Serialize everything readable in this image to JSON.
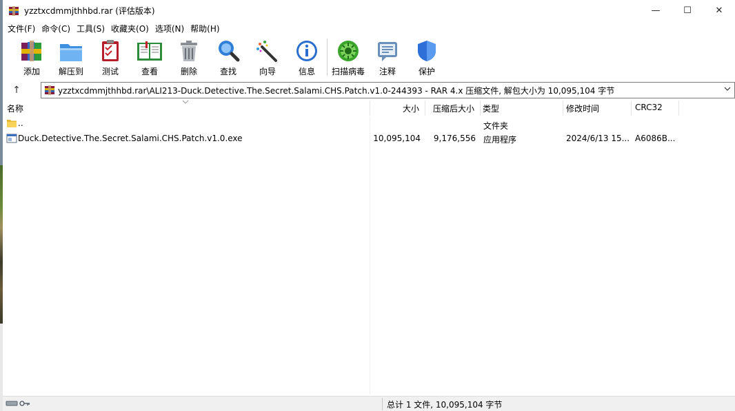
{
  "window": {
    "title": "yzztxcdmmjthhbd.rar (评估版本)",
    "minimize_glyph": "—",
    "maximize_glyph": "☐",
    "close_glyph": "✕"
  },
  "menu": [
    "文件(F)",
    "命令(C)",
    "工具(S)",
    "收藏夹(O)",
    "选项(N)",
    "帮助(H)"
  ],
  "toolbar": [
    {
      "label": "添加",
      "icon": "archive-books-icon"
    },
    {
      "label": "解压到",
      "icon": "folder-extract-icon"
    },
    {
      "label": "测试",
      "icon": "checklist-icon"
    },
    {
      "label": "查看",
      "icon": "open-book-icon"
    },
    {
      "label": "删除",
      "icon": "trash-bin-icon"
    },
    {
      "label": "查找",
      "icon": "magnifier-icon"
    },
    {
      "label": "向导",
      "icon": "magic-wand-icon"
    },
    {
      "label": "信息",
      "icon": "info-icon"
    },
    {
      "label": "扫描病毒",
      "icon": "virus-scan-icon"
    },
    {
      "label": "注释",
      "icon": "comment-icon"
    },
    {
      "label": "保护",
      "icon": "shield-icon"
    }
  ],
  "address": {
    "path": "yzztxcdmmjthhbd.rar\\ALI213-Duck.Detective.The.Secret.Salami.CHS.Patch.v1.0-244393 - RAR 4.x 压缩文件, 解包大小为 10,095,104 字节",
    "up_glyph": "↑"
  },
  "columns": {
    "name": "名称",
    "size": "大小",
    "packed": "压缩后大小",
    "type": "类型",
    "modified": "修改时间",
    "crc": "CRC32"
  },
  "rows": [
    {
      "name": "..",
      "size": "",
      "packed": "",
      "type": "文件夹",
      "modified": "",
      "crc": "",
      "icon": "folder-up-icon"
    },
    {
      "name": "Duck.Detective.The.Secret.Salami.CHS.Patch.v1.0.exe",
      "size": "10,095,104",
      "packed": "9,176,556",
      "type": "应用程序",
      "modified": "2024/6/13 15...",
      "crc": "A6086B...",
      "icon": "exe-file-icon"
    }
  ],
  "status": {
    "summary": "总计 1 文件, 10,095,104 字节"
  },
  "colors": {
    "accent_blue": "#1e73d8",
    "scan_green": "#3aa52a"
  }
}
